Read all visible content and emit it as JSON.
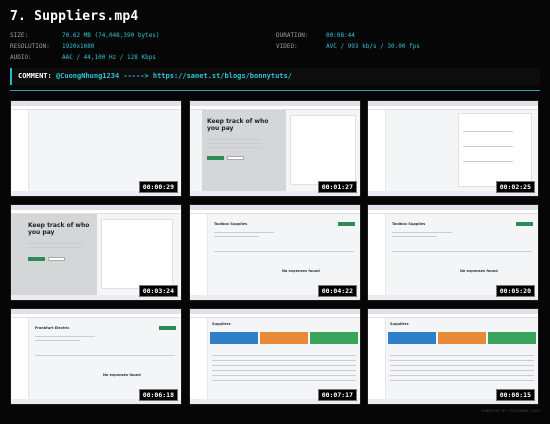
{
  "title": "7. Suppliers.mp4",
  "meta": {
    "size_label": "SIZE:",
    "size_value": "70.62 MB (74,048,390 bytes)",
    "resolution_label": "RESOLUTION:",
    "resolution_value": "1920x1080",
    "audio_label": "AUDIO:",
    "audio_value": "AAC / 44,100 Hz / 128 Kbps",
    "duration_label": "DURATION:",
    "duration_value": "00:08:44",
    "video_label": "VIDEO:",
    "video_value": "AVC / 993 kb/s / 30.00 fps"
  },
  "comment": {
    "label": "COMMENT:",
    "text": "@CuongNhung1234 -----> https://sanet.st/blogs/bonnytuts/"
  },
  "thumbnails": [
    {
      "timestamp": "00:00:29",
      "kind": "blank"
    },
    {
      "timestamp": "00:01:27",
      "kind": "hero",
      "hero_text": "Keep track of who you pay"
    },
    {
      "timestamp": "00:02:25",
      "kind": "form"
    },
    {
      "timestamp": "00:03:24",
      "kind": "hero-form",
      "hero_text": "Keep track of who you pay"
    },
    {
      "timestamp": "00:04:22",
      "kind": "detail",
      "heading": "Toolbox Supplies",
      "empty_text": "No expenses found"
    },
    {
      "timestamp": "00:05:20",
      "kind": "detail",
      "heading": "Toolbox Supplies",
      "empty_text": "No expenses found"
    },
    {
      "timestamp": "00:06:18",
      "kind": "detail2",
      "heading": "Frankfurt Electric",
      "empty_text": "No expenses found"
    },
    {
      "timestamp": "00:07:17",
      "kind": "list",
      "heading": "Suppliers"
    },
    {
      "timestamp": "00:08:15",
      "kind": "list",
      "heading": "Suppliers"
    }
  ],
  "footer": "GENERATED BY VIDEOGRAPH 2022",
  "colors": {
    "accent": "#2fc3d6",
    "bar": "#2a9fb0",
    "card_blue": "#2f80c8",
    "card_orange": "#e8893a",
    "card_green": "#3aa55d"
  }
}
